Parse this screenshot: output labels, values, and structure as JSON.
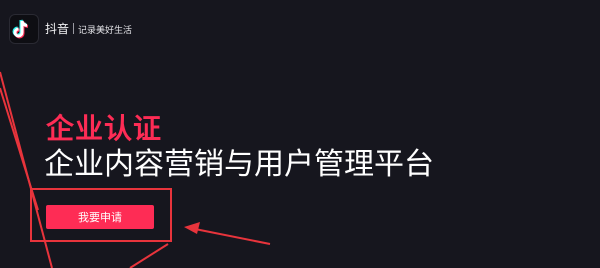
{
  "header": {
    "app_name": "抖音",
    "slogan": "记录美好生活",
    "logo_icon": "tiktok-note-icon"
  },
  "hero": {
    "title_highlight": "企业认证",
    "title_main": "企业内容营销与用户管理平台",
    "apply_button_label": "我要申请"
  },
  "annotations": {
    "color": "#e8343c"
  },
  "colors": {
    "brand_red": "#fe2c55",
    "background": "#16161e"
  }
}
